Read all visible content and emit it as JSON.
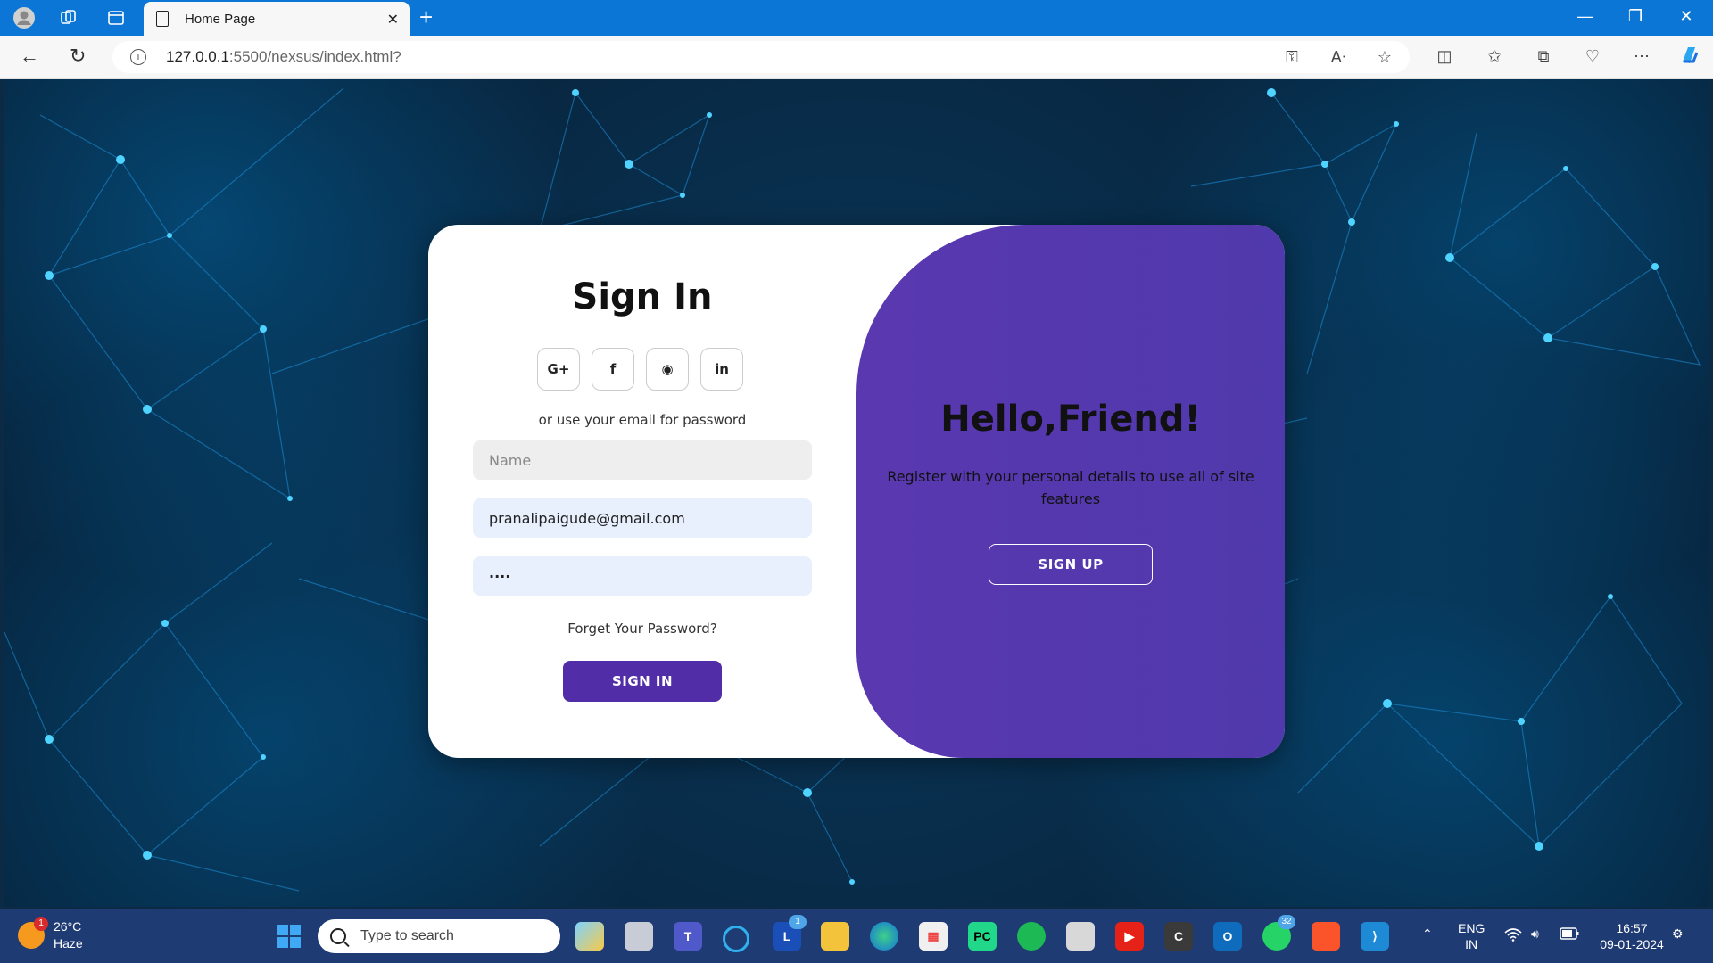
{
  "browser": {
    "tab_title": "Home Page",
    "url_host": "127.0.0.1",
    "url_path": ":5500/nexsus/index.html?"
  },
  "signin": {
    "title": "Sign In",
    "social_buttons": [
      "G+",
      "f",
      "◉",
      "in"
    ],
    "divider_text": "or use your email for password",
    "name_placeholder": "Name",
    "email_value": "pranalipaigude@gmail.com",
    "password_value": "····",
    "forgot_text": "Forget Your Password?",
    "button_label": "SIGN IN"
  },
  "panel": {
    "title": "Hello,Friend!",
    "text": "Register with your personal details to use all of site features",
    "button_label": "SIGN UP"
  },
  "taskbar": {
    "weather_temp": "26°C",
    "weather_desc": "Haze",
    "weather_badge": "1",
    "search_placeholder": "Type to search",
    "l_app_badge": "1",
    "whatsapp_badge": "32",
    "lang_line1": "ENG",
    "lang_line2": "IN",
    "time": "16:57",
    "date": "09-01-2024"
  },
  "colors": {
    "accent": "#512da8",
    "chrome": "#0b76d6",
    "taskbar": "#1f3b73"
  }
}
